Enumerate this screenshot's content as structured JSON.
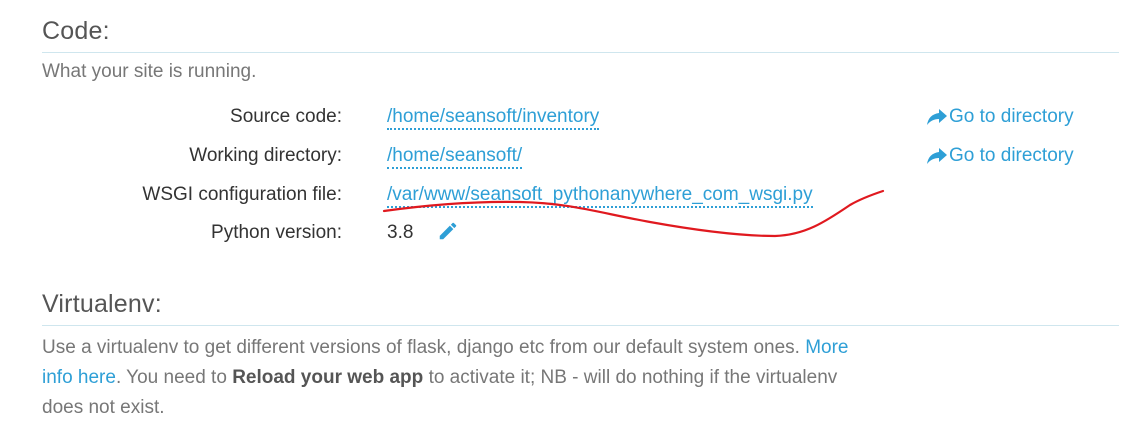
{
  "code_section": {
    "title": "Code:",
    "description": "What your site is running.",
    "rows": [
      {
        "label": "Source code:",
        "value": "/home/seansoft/inventory",
        "action": "Go to directory"
      },
      {
        "label": "Working directory:",
        "value": "/home/seansoft/",
        "action": "Go to directory"
      },
      {
        "label": "WSGI configuration file:",
        "value": "/var/www/seansoft_pythonanywhere_com_wsgi.py"
      },
      {
        "label": "Python version:",
        "value": "3.8"
      }
    ],
    "icons": {
      "edit": "pencil-icon",
      "go_to_directory": "share-arrow-icon"
    }
  },
  "virtualenv_section": {
    "title": "Virtualenv:",
    "text_1": "Use a virtualenv to get different versions of flask, django etc from our default system ones.",
    "more_info_link": "More info here",
    "text_2": ". You need to",
    "reload_bold": "Reload your web app",
    "text_3": "to activate it; NB - will do nothing if the virtualenv does not exist."
  },
  "colors": {
    "link": "#2e9fd6",
    "annotation_scribble": "#e0191f"
  }
}
